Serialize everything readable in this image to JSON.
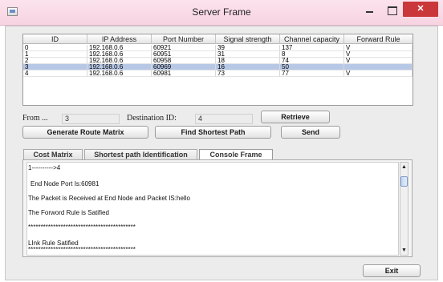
{
  "window": {
    "title": "Server Frame",
    "close_glyph": "✕"
  },
  "table": {
    "columns": [
      "ID",
      "IP Address",
      "Port Number",
      "Signal strength",
      "Channel capacity",
      "Forward Rule"
    ],
    "rows": [
      [
        "0",
        "192.168.0.6",
        "60921",
        "39",
        "137",
        "V"
      ],
      [
        "1",
        "192.168.0.6",
        "60951",
        "31",
        "8",
        "V"
      ],
      [
        "2",
        "192.168.0.6",
        "60958",
        "18",
        "74",
        "V"
      ],
      [
        "3",
        "192.168.0.6",
        "60969",
        "16",
        "50",
        ""
      ],
      [
        "4",
        "192.168.0.6",
        "60981",
        "73",
        "77",
        "V"
      ]
    ],
    "selected_row": 3,
    "selection_color": "#b7c8e6"
  },
  "form": {
    "from_label": "From ...",
    "from_value": "3",
    "dest_label": "Destination ID:",
    "dest_value": "4",
    "retrieve_label": "Retrieve",
    "generate_label": "Generate Route Matrix",
    "shortest_label": "Find Shortest Path",
    "send_label": "Send"
  },
  "tabs": [
    "Cost Matrix",
    "Shortest path Identification",
    "Console Frame"
  ],
  "active_tab": 2,
  "console": {
    "lines": [
      "1---------->4",
      "End Node Port Is:60981",
      "The Packet is Received at End Node and Packet IS:hello",
      "The Forword Rule is Satified",
      "*******************************************",
      "LInk Rule Satified",
      "*******************************************"
    ]
  },
  "exit_label": "Exit",
  "icons": {
    "app": "window-icon",
    "scroll_up": "▲",
    "scroll_down": "▼"
  }
}
